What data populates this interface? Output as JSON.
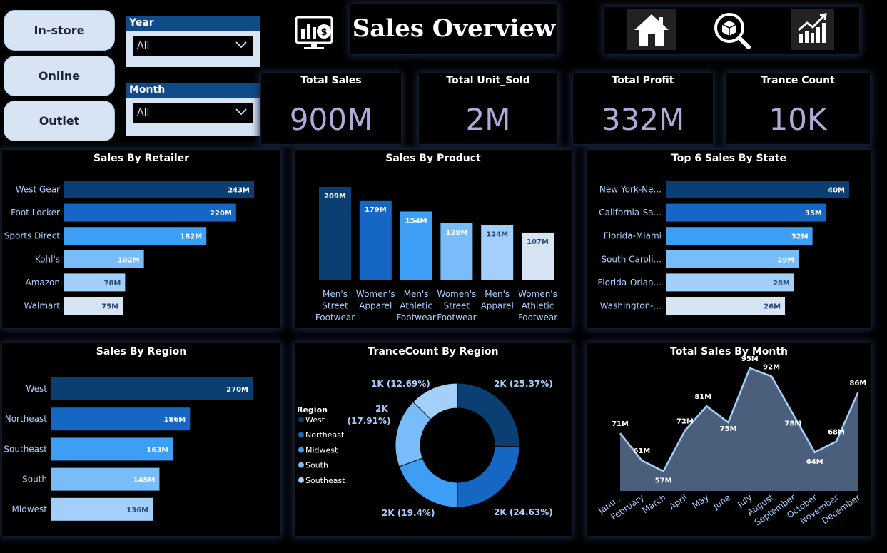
{
  "slicers": {
    "btn_instore": "In-store",
    "btn_online": "Online",
    "btn_outlet": "Outlet"
  },
  "filters": {
    "year": {
      "label": "Year",
      "value": "All"
    },
    "month": {
      "label": "Month",
      "value": "All"
    }
  },
  "header": {
    "title": "Sales Overview"
  },
  "nav": {
    "icons": [
      "home-icon",
      "search-package-icon",
      "growth-chart-icon"
    ]
  },
  "kpis": [
    {
      "label": "Total Sales",
      "value": "900M"
    },
    {
      "label": "Total Unit_Sold",
      "value": "2M"
    },
    {
      "label": "Total Profit",
      "value": "332M"
    },
    {
      "label": "Trance Count",
      "value": "10K"
    }
  ],
  "colors": {
    "c1": "#0b3f73",
    "c2": "#1666c4",
    "c3": "#3d9ef5",
    "c4": "#78bdfa",
    "c5": "#a3d0fb",
    "c6": "#d6e4f3",
    "label": "#a8cfff",
    "area": "#4b5e7c"
  },
  "chart_data": [
    {
      "id": "retailer",
      "type": "bar",
      "orientation": "horizontal",
      "title": "Sales By Retailer",
      "categories": [
        "West Gear",
        "Foot Locker",
        "Sports Direct",
        "Kohl's",
        "Amazon",
        "Walmart"
      ],
      "values": [
        243,
        220,
        182,
        102,
        78,
        75
      ],
      "labels": [
        "243M",
        "220M",
        "182M",
        "102M",
        "78M",
        "75M"
      ]
    },
    {
      "id": "product",
      "type": "bar",
      "orientation": "vertical",
      "title": "Sales By Product",
      "categories": [
        "Men's Street Footwear",
        "Women's Apparel",
        "Men's Athletic Footwear",
        "Women's Street Footwear",
        "Men's Apparel",
        "Women's Athletic Footwear"
      ],
      "values": [
        209,
        179,
        154,
        128,
        124,
        107
      ],
      "labels": [
        "209M",
        "179M",
        "154M",
        "128M",
        "124M",
        "107M"
      ]
    },
    {
      "id": "state",
      "type": "bar",
      "orientation": "horizontal",
      "title": "Top 6 Sales By State",
      "categories": [
        "New York-Ne...",
        "California-Sa...",
        "Florida-Miami",
        "South Caroli...",
        "Florida-Orlan...",
        "Washington-..."
      ],
      "values": [
        40,
        35,
        32,
        29,
        28,
        26
      ],
      "labels": [
        "40M",
        "35M",
        "32M",
        "29M",
        "28M",
        "26M"
      ]
    },
    {
      "id": "region",
      "type": "bar",
      "orientation": "horizontal",
      "title": "Sales By Region",
      "categories": [
        "West",
        "Northeast",
        "Southeast",
        "South",
        "Midwest"
      ],
      "values": [
        270,
        186,
        163,
        145,
        136
      ],
      "labels": [
        "270M",
        "186M",
        "163M",
        "145M",
        "136M"
      ]
    },
    {
      "id": "donut",
      "type": "pie",
      "title": "TranceCount By Region",
      "legend_title": "Region",
      "categories": [
        "West",
        "Northeast",
        "Midwest",
        "South",
        "Southeast"
      ],
      "values": [
        25.37,
        24.63,
        19.4,
        17.91,
        12.69
      ],
      "labels": [
        "2K (25.37%)",
        "2K (24.63%)",
        "2K (19.4%)",
        "2K",
        "1K (12.69%)"
      ],
      "sublabel": "(17.91%)"
    },
    {
      "id": "month",
      "type": "area",
      "title": "Total Sales By Month",
      "categories": [
        "Janu...",
        "February",
        "March",
        "April",
        "May",
        "June",
        "July",
        "August",
        "September",
        "October",
        "November",
        "December"
      ],
      "values": [
        71,
        61,
        57,
        72,
        81,
        75,
        95,
        92,
        78,
        64,
        68,
        86
      ],
      "labels": [
        "71M",
        "61M",
        "57M",
        "72M",
        "81M",
        "75M",
        "95M",
        "92M",
        "78M",
        "64M",
        "68M",
        "86M"
      ]
    }
  ]
}
